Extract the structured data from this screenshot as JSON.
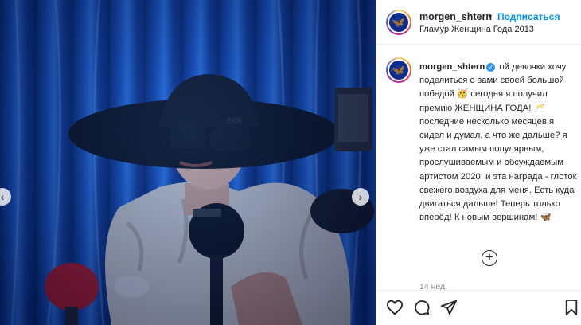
{
  "post": {
    "username": "morgen_shtern",
    "follow_label": "Подписаться",
    "dot": "•",
    "location": "Гламур Женщина Года 2013",
    "avatar_glyph": "🦋",
    "caption": {
      "username": "morgen_shtern",
      "verified_glyph": "✓",
      "text": "ой девочки хочу поделиться с вами своей большой победой 🥳 сегодня я получил премию ЖЕНЩИНА ГОДА! 🥂 последние несколько месяцев я сидел и думал, а что же дальше? я уже стал самым популярным, прослушиваемым и обсуждаемым артистом 2020, и эта награда - глоток свежего воздуха для меня. Есть куда двигаться дальше! Теперь только вперёд! К новым вершинам! 🦋"
    },
    "time_ago": "14 нед."
  },
  "icons": {
    "load_more": "+",
    "carousel_prev": "‹",
    "carousel_next": "›",
    "like": "heart-icon",
    "comment": "comment-icon",
    "share": "share-icon",
    "save": "bookmark-icon"
  },
  "colors": {
    "accent": "#0095f6",
    "verified": "#3897f0",
    "backdrop": "#1a56c4"
  }
}
